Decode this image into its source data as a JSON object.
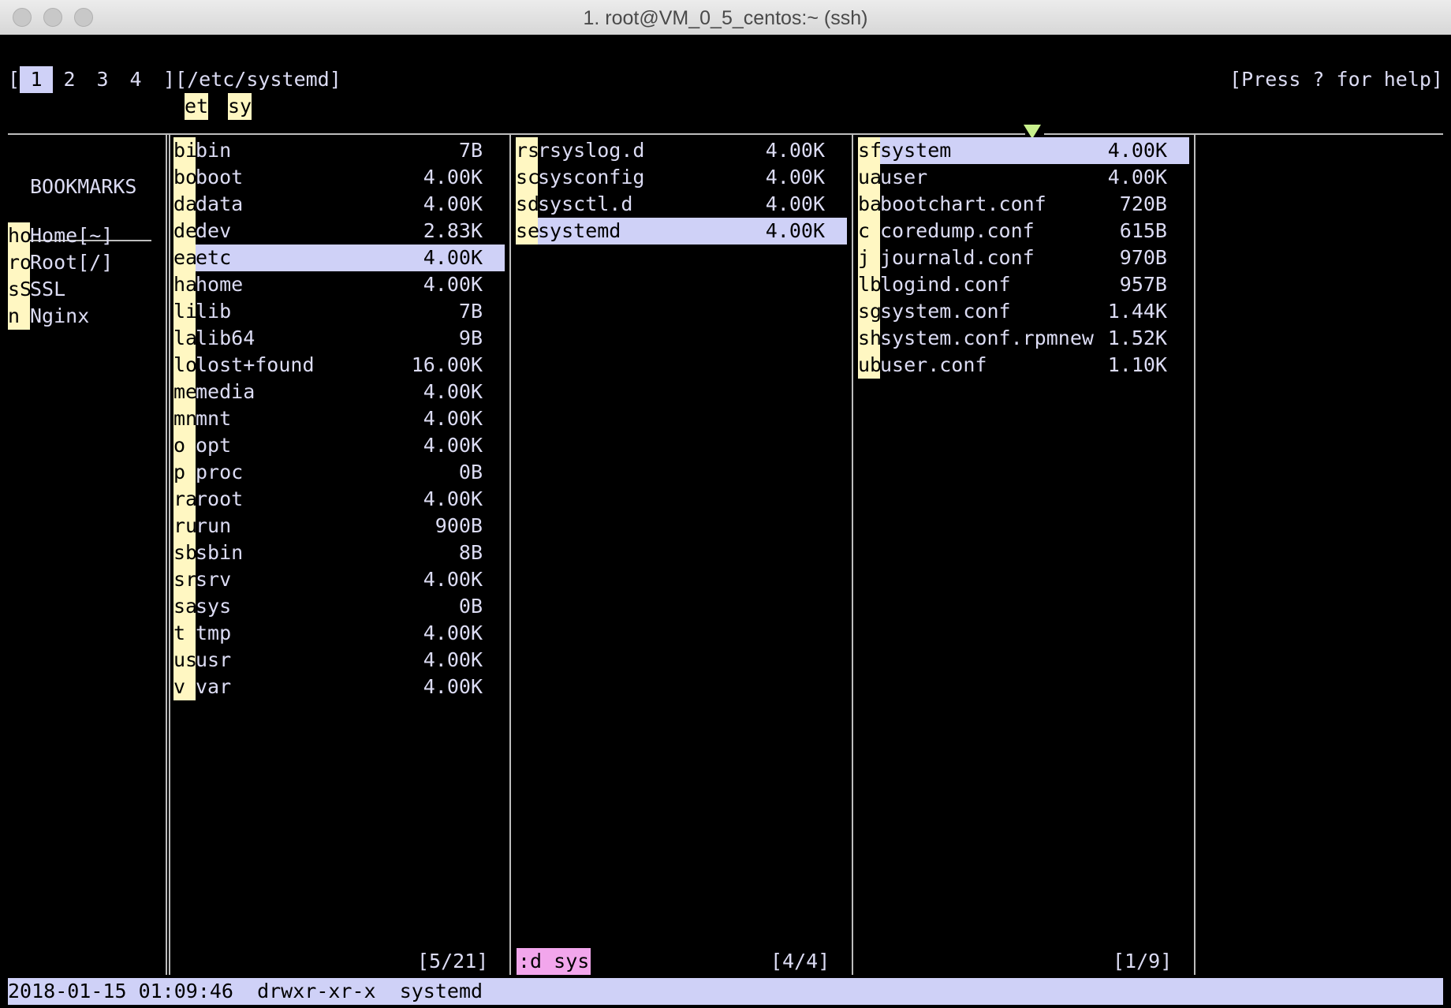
{
  "window": {
    "title": "1. root@VM_0_5_centos:~ (ssh)"
  },
  "header": {
    "open_bracket": "[",
    "tabs": [
      "1",
      "2",
      "3",
      "4"
    ],
    "path": "][/etc/systemd]",
    "help": "[Press ? for help]",
    "crumbs": [
      "et",
      "sy"
    ]
  },
  "bookmarks": {
    "title": "BOOKMARKS",
    "items": [
      {
        "key": "ho",
        "label": "Home[~]"
      },
      {
        "key": "ro",
        "label": "Root[/]"
      },
      {
        "key": "sS",
        "label": "SSL"
      },
      {
        "key": "n",
        "label": "Nginx"
      }
    ]
  },
  "col1": {
    "items": [
      {
        "key": "bi",
        "name": "bin",
        "size": "7B"
      },
      {
        "key": "bo",
        "name": "boot",
        "size": "4.00K"
      },
      {
        "key": "da",
        "name": "data",
        "size": "4.00K"
      },
      {
        "key": "de",
        "name": "dev",
        "size": "2.83K"
      },
      {
        "key": "ea",
        "name": "etc",
        "size": "4.00K"
      },
      {
        "key": "ha",
        "name": "home",
        "size": "4.00K"
      },
      {
        "key": "li",
        "name": "lib",
        "size": "7B"
      },
      {
        "key": "la",
        "name": "lib64",
        "size": "9B"
      },
      {
        "key": "lo",
        "name": "lost+found",
        "size": "16.00K"
      },
      {
        "key": "me",
        "name": "media",
        "size": "4.00K"
      },
      {
        "key": "mn",
        "name": "mnt",
        "size": "4.00K"
      },
      {
        "key": "o",
        "name": "opt",
        "size": "4.00K"
      },
      {
        "key": "p",
        "name": "proc",
        "size": "0B"
      },
      {
        "key": "ra",
        "name": "root",
        "size": "4.00K"
      },
      {
        "key": "ru",
        "name": "run",
        "size": "900B"
      },
      {
        "key": "sb",
        "name": "sbin",
        "size": "8B"
      },
      {
        "key": "sr",
        "name": "srv",
        "size": "4.00K"
      },
      {
        "key": "sa",
        "name": "sys",
        "size": "0B"
      },
      {
        "key": "t",
        "name": "tmp",
        "size": "4.00K"
      },
      {
        "key": "us",
        "name": "usr",
        "size": "4.00K"
      },
      {
        "key": "v",
        "name": "var",
        "size": "4.00K"
      }
    ],
    "count": "[5/21]"
  },
  "col2": {
    "items": [
      {
        "key": "rs",
        "name": "rsyslog.d",
        "size": "4.00K"
      },
      {
        "key": "sc",
        "name": "sysconfig",
        "size": "4.00K"
      },
      {
        "key": "sd",
        "name": "sysctl.d",
        "size": "4.00K"
      },
      {
        "key": "se",
        "name": "systemd",
        "size": "4.00K"
      }
    ],
    "count": "[4/4]",
    "filter": ":d sys"
  },
  "col3": {
    "items": [
      {
        "key": "sf",
        "name": "system",
        "size": "4.00K"
      },
      {
        "key": "ua",
        "name": "user",
        "size": "4.00K"
      },
      {
        "key": "ba",
        "name": "bootchart.conf",
        "size": "720B"
      },
      {
        "key": "c",
        "name": "coredump.conf",
        "size": "615B"
      },
      {
        "key": "j",
        "name": "journald.conf",
        "size": "970B"
      },
      {
        "key": "lb",
        "name": "logind.conf",
        "size": "957B"
      },
      {
        "key": "sg",
        "name": "system.conf",
        "size": "1.44K"
      },
      {
        "key": "sh",
        "name": "system.conf.rpmnew",
        "size": "1.52K"
      },
      {
        "key": "ub",
        "name": "user.conf",
        "size": "1.10K"
      }
    ],
    "count": "[1/9]"
  },
  "status": {
    "text": "2018-01-15 01:09:46  drwxr-xr-x  systemd"
  }
}
